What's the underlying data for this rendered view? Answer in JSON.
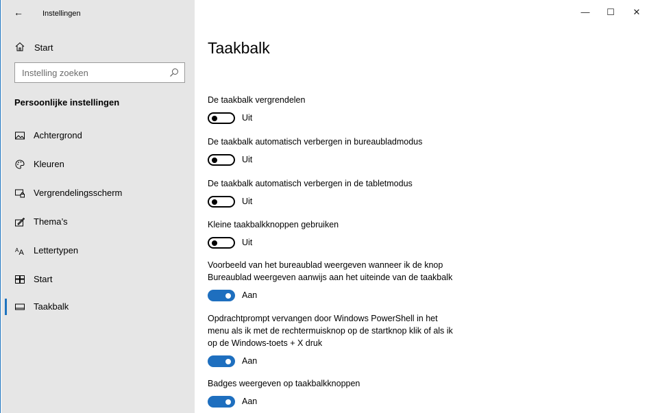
{
  "window": {
    "title": "Instellingen",
    "controls": {
      "minimize": "—",
      "maximize": "☐",
      "close": "✕"
    }
  },
  "sidebar": {
    "back_glyph": "←",
    "home_label": "Start",
    "search_placeholder": "Instelling zoeken",
    "section_heading": "Persoonlijke instellingen",
    "items": [
      {
        "label": "Achtergrond",
        "icon": "picture-icon"
      },
      {
        "label": "Kleuren",
        "icon": "palette-icon"
      },
      {
        "label": "Vergrendelingsscherm",
        "icon": "lock-screen-icon"
      },
      {
        "label": "Thema’s",
        "icon": "brush-icon"
      },
      {
        "label": "Lettertypen",
        "icon": "font-icon"
      },
      {
        "label": "Start",
        "icon": "start-tiles-icon"
      },
      {
        "label": "Taakbalk",
        "icon": "taskbar-icon",
        "selected": true
      }
    ]
  },
  "main": {
    "title": "Taakbalk",
    "settings": [
      {
        "label": "De taakbalk vergrendelen",
        "state": "Uit",
        "on": false
      },
      {
        "label": "De taakbalk automatisch verbergen in bureaubladmodus",
        "state": "Uit",
        "on": false
      },
      {
        "label": "De taakbalk automatisch verbergen in de tabletmodus",
        "state": "Uit",
        "on": false
      },
      {
        "label": "Kleine taakbalkknoppen gebruiken",
        "state": "Uit",
        "on": false
      },
      {
        "label_lines": [
          "Voorbeeld van het bureaublad weergeven wanneer ik de knop",
          "Bureaublad weergeven aanwijs aan het uiteinde van de taakbalk"
        ],
        "state": "Aan",
        "on": true
      },
      {
        "label_lines": [
          "Opdrachtprompt vervangen door Windows PowerShell in het",
          "menu als ik met de rechtermuisknop op de startknop klik of als ik",
          "op de Windows-toets + X druk"
        ],
        "state": "Aan",
        "on": true
      },
      {
        "label": "Badges weergeven op taakbalkknoppen",
        "state": "Aan",
        "on": true
      }
    ]
  },
  "colors": {
    "accent": "#1e6fbf",
    "sidebar_bg": "#e6e6e6"
  }
}
